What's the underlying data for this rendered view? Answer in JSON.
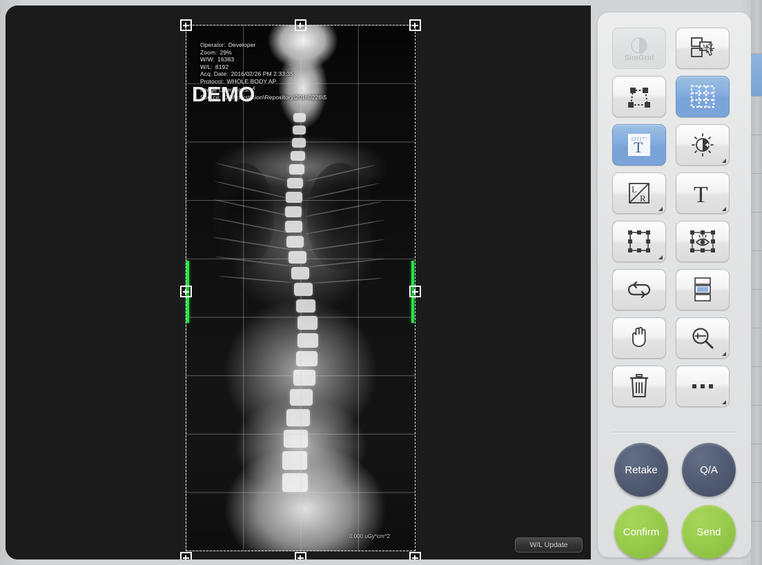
{
  "viewport": {
    "overlay": {
      "rows": [
        {
          "label": "Operator:",
          "value": "Developer"
        },
        {
          "label": "Zoom:",
          "value": "29%"
        },
        {
          "label": "W/W:",
          "value": "16383"
        },
        {
          "label": "W/L:",
          "value": "8192"
        },
        {
          "label": "Acq. Date:",
          "value": "2016/02/26 PM 2:33:35"
        },
        {
          "label": "Protocol:",
          "value": "WHOLE BODY AP"
        },
        {
          "label": "Image Operations:",
          "value": "4"
        },
        {
          "label": "Source:",
          "value": "D:\\Workstation\\Repository\\20160226\\5"
        }
      ],
      "watermark": "DEMO",
      "dose": "0.000 uGy*cm^2"
    },
    "wl_update_label": "W/L Update"
  },
  "toolbar": {
    "buttons": [
      {
        "name": "simgrid-button",
        "label": "SimGrid",
        "icon": "simgrid-icon",
        "state": "disabled"
      },
      {
        "name": "manual-stitch-button",
        "label": "Manual Stitching",
        "icon": "manual-stitch-icon",
        "state": "normal"
      },
      {
        "name": "auto-stitch-button",
        "label": "Auto Stitching",
        "icon": "auto-stitch-icon",
        "state": "normal"
      },
      {
        "name": "grid-button",
        "label": "Grid",
        "icon": "grid-icon",
        "state": "active"
      },
      {
        "name": "text-overlay-button",
        "label": "Text Overlay",
        "icon": "text-overlay-icon",
        "state": "active"
      },
      {
        "name": "brightness-button",
        "label": "Brightness/Contrast",
        "icon": "brightness-icon",
        "state": "normal"
      },
      {
        "name": "lr-marker-button",
        "label": "L/R Marker",
        "icon": "lr-marker-icon",
        "state": "normal"
      },
      {
        "name": "annotation-text-button",
        "label": "Text Annotation",
        "icon": "text-t-icon",
        "state": "normal"
      },
      {
        "name": "crop-button",
        "label": "Crop",
        "icon": "crop-icon",
        "state": "normal"
      },
      {
        "name": "roi-view-button",
        "label": "ROI View",
        "icon": "roi-eye-icon",
        "state": "normal"
      },
      {
        "name": "flip-rotate-button",
        "label": "Flip / Rotate",
        "icon": "flip-rotate-icon",
        "state": "normal"
      },
      {
        "name": "image-select-button",
        "label": "Image Select",
        "icon": "filmstrip-icon",
        "state": "normal"
      },
      {
        "name": "pan-button",
        "label": "Pan",
        "icon": "hand-icon",
        "state": "normal"
      },
      {
        "name": "zoom-button",
        "label": "Zoom",
        "icon": "magnifier-icon",
        "state": "normal"
      },
      {
        "name": "delete-button",
        "label": "Delete",
        "icon": "trash-icon",
        "state": "normal"
      },
      {
        "name": "more-button",
        "label": "More",
        "icon": "ellipsis-icon",
        "state": "normal"
      }
    ],
    "actions": [
      {
        "name": "retake-button",
        "label": "Retake",
        "style": "dark"
      },
      {
        "name": "qa-button",
        "label": "Q/A",
        "style": "dark"
      },
      {
        "name": "confirm-button",
        "label": "Confirm",
        "style": "green"
      },
      {
        "name": "send-button",
        "label": "Send",
        "style": "green"
      }
    ]
  },
  "colors": {
    "accent_blue": "#7ba4d9",
    "green_action": "#97ca4b",
    "dark_action": "#515b72",
    "collimation_green": "#22e844",
    "panel_bg": "#e3e4e5",
    "canvas_bg": "#191919"
  }
}
